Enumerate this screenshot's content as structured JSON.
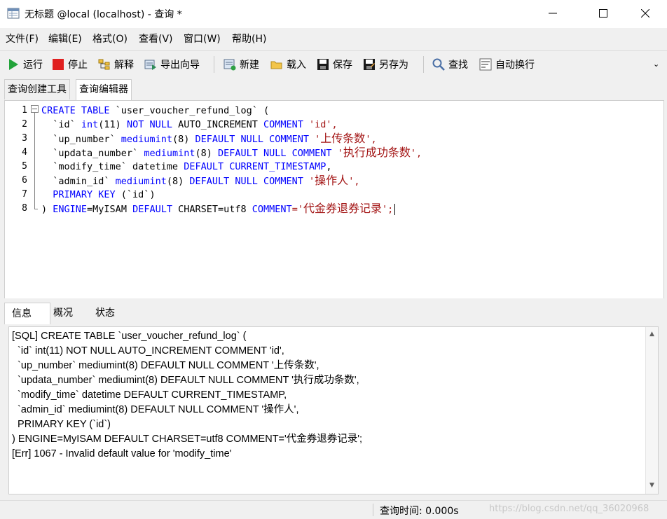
{
  "window": {
    "title": "无标题 @local (localhost) - 查询 *",
    "minimize": "—",
    "maximize": "☐",
    "close": "✕"
  },
  "menu": [
    "文件(F)",
    "编辑(E)",
    "格式(O)",
    "查看(V)",
    "窗口(W)",
    "帮助(H)"
  ],
  "toolbar": {
    "run": "运行",
    "stop": "停止",
    "explain": "解释",
    "export_wizard": "导出向导",
    "new": "新建",
    "load": "载入",
    "save": "保存",
    "save_as": "另存为",
    "find": "查找",
    "word_wrap": "自动换行",
    "more": "⌄"
  },
  "tabs": [
    "查询创建工具",
    "查询编辑器"
  ],
  "active_tab": "查询编辑器",
  "editor": {
    "line_numbers": [
      "1",
      "2",
      "3",
      "4",
      "5",
      "6",
      "7",
      "8"
    ],
    "lines": [
      [
        {
          "t": "CREATE TABLE",
          "c": "kw"
        },
        {
          "t": " `user_voucher_refund_log` (",
          "c": "tx"
        }
      ],
      [
        {
          "t": "  `id` ",
          "c": "tx"
        },
        {
          "t": "int",
          "c": "fn"
        },
        {
          "t": "(11) ",
          "c": "tx"
        },
        {
          "t": "NOT NULL",
          "c": "kw"
        },
        {
          "t": " AUTO_INCREMENT ",
          "c": "tx"
        },
        {
          "t": "COMMENT",
          "c": "kw"
        },
        {
          "t": " 'id',",
          "c": "str"
        }
      ],
      [
        {
          "t": "  `up_number` ",
          "c": "tx"
        },
        {
          "t": "mediumint",
          "c": "fn"
        },
        {
          "t": "(8) ",
          "c": "tx"
        },
        {
          "t": "DEFAULT NULL COMMENT",
          "c": "kw"
        },
        {
          "t": " '",
          "c": "str"
        },
        {
          "t": "上传条数",
          "c": "strcn"
        },
        {
          "t": "',",
          "c": "str"
        }
      ],
      [
        {
          "t": "  `updata_number` ",
          "c": "tx"
        },
        {
          "t": "mediumint",
          "c": "fn"
        },
        {
          "t": "(8) ",
          "c": "tx"
        },
        {
          "t": "DEFAULT NULL COMMENT",
          "c": "kw"
        },
        {
          "t": " '",
          "c": "str"
        },
        {
          "t": "执行成功条数",
          "c": "strcn"
        },
        {
          "t": "',",
          "c": "str"
        }
      ],
      [
        {
          "t": "  `modify_time` datetime ",
          "c": "tx"
        },
        {
          "t": "DEFAULT CURRENT_TIMESTAMP",
          "c": "kw"
        },
        {
          "t": ",",
          "c": "tx"
        }
      ],
      [
        {
          "t": "  `admin_id` ",
          "c": "tx"
        },
        {
          "t": "mediumint",
          "c": "fn"
        },
        {
          "t": "(8) ",
          "c": "tx"
        },
        {
          "t": "DEFAULT NULL COMMENT",
          "c": "kw"
        },
        {
          "t": " '",
          "c": "str"
        },
        {
          "t": "操作人",
          "c": "strcn"
        },
        {
          "t": "',",
          "c": "str"
        }
      ],
      [
        {
          "t": "  ",
          "c": "tx"
        },
        {
          "t": "PRIMARY KEY",
          "c": "kw"
        },
        {
          "t": " (`id`)",
          "c": "tx"
        }
      ],
      [
        {
          "t": ") ",
          "c": "tx"
        },
        {
          "t": "ENGINE",
          "c": "kw"
        },
        {
          "t": "=MyISAM ",
          "c": "tx"
        },
        {
          "t": "DEFAULT",
          "c": "kw"
        },
        {
          "t": " CHARSET=utf8 ",
          "c": "tx"
        },
        {
          "t": "COMMENT",
          "c": "kw"
        },
        {
          "t": "='",
          "c": "str"
        },
        {
          "t": "代金券退券记录",
          "c": "strcn"
        },
        {
          "t": "';",
          "c": "str"
        }
      ]
    ]
  },
  "bottom_tabs": [
    "信息",
    "概况",
    "状态"
  ],
  "active_bottom_tab": "信息",
  "info_lines": [
    "[SQL] CREATE TABLE `user_voucher_refund_log` (",
    "  `id` int(11) NOT NULL AUTO_INCREMENT COMMENT 'id',",
    "  `up_number` mediumint(8) DEFAULT NULL COMMENT '上传条数',",
    "  `updata_number` mediumint(8) DEFAULT NULL COMMENT '执行成功条数',",
    "  `modify_time` datetime DEFAULT CURRENT_TIMESTAMP,",
    "  `admin_id` mediumint(8) DEFAULT NULL COMMENT '操作人',",
    "  PRIMARY KEY (`id`)",
    ") ENGINE=MyISAM DEFAULT CHARSET=utf8 COMMENT='代金券退券记录';",
    "[Err] 1067 - Invalid default value for 'modify_time'"
  ],
  "status": {
    "query_time": "查询时间: 0.000s",
    "watermark": "https://blog.csdn.net/qq_36020968"
  },
  "colors": {
    "keyword": "#0000ff",
    "string": "#a31515",
    "stop_red": "#e02020",
    "run_green": "#22a33a"
  }
}
